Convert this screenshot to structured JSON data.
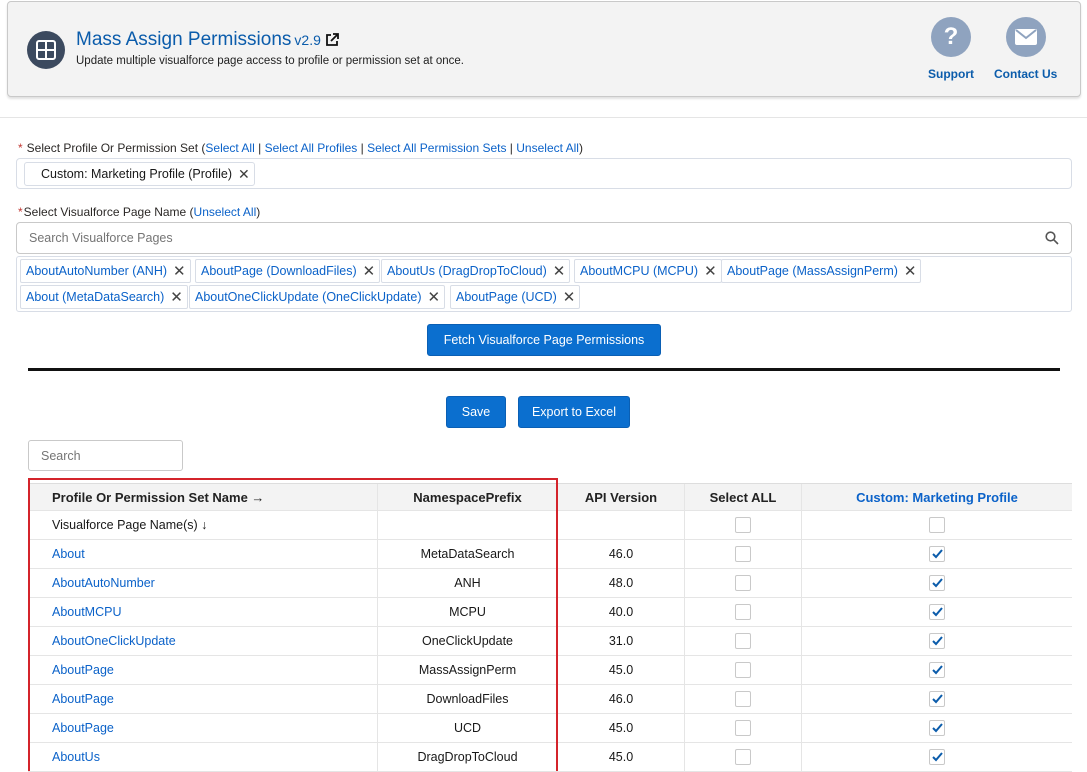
{
  "header": {
    "title": "Mass Assign Permissions",
    "version": "v2.9",
    "subtitle": "Update multiple visualforce page access to profile or permission set at once.",
    "support_label": "Support",
    "contact_label": "Contact Us"
  },
  "profile_select": {
    "required_mark": "*",
    "label": "Select Profile Or Permission Set (",
    "select_all": "Select All",
    "sep1": " | ",
    "select_all_profiles": "Select All Profiles",
    "sep2": " | ",
    "select_all_permsets": "Select All Permission Sets",
    "sep3": " | ",
    "unselect_all": "Unselect All",
    "close_paren": ")",
    "selected_pill": "Custom: Marketing Profile (Profile)"
  },
  "vf_select": {
    "required_mark": "*",
    "label": "Select Visualforce Page Name (",
    "unselect_all": "Unselect All",
    "close_paren": ")",
    "search_placeholder": "Search Visualforce Pages",
    "pills": [
      "AboutAutoNumber (ANH)",
      "AboutPage (DownloadFiles)",
      "AboutUs (DragDropToCloud)",
      "AboutMCPU (MCPU)",
      "AboutPage (MassAssignPerm)",
      "About (MetaDataSearch)",
      "AboutOneClickUpdate (OneClickUpdate)",
      "AboutPage (UCD)"
    ]
  },
  "buttons": {
    "fetch": "Fetch Visualforce Page Permissions",
    "save": "Save",
    "export": "Export to Excel"
  },
  "table_search_placeholder": "Search",
  "table": {
    "headers": [
      "Profile Or Permission Set Name →",
      "NamespacePrefix",
      "API Version",
      "Select ALL",
      "Custom: Marketing Profile"
    ],
    "subheader_label": "Visualforce Page Name(s) ↓",
    "rows": [
      {
        "name": "About",
        "ns": "MetaDataSearch",
        "api": "46.0",
        "select_all": false,
        "marketing": true
      },
      {
        "name": "AboutAutoNumber",
        "ns": "ANH",
        "api": "48.0",
        "select_all": false,
        "marketing": true
      },
      {
        "name": "AboutMCPU",
        "ns": "MCPU",
        "api": "40.0",
        "select_all": false,
        "marketing": true
      },
      {
        "name": "AboutOneClickUpdate",
        "ns": "OneClickUpdate",
        "api": "31.0",
        "select_all": false,
        "marketing": true
      },
      {
        "name": "AboutPage",
        "ns": "MassAssignPerm",
        "api": "45.0",
        "select_all": false,
        "marketing": true
      },
      {
        "name": "AboutPage",
        "ns": "DownloadFiles",
        "api": "46.0",
        "select_all": false,
        "marketing": true
      },
      {
        "name": "AboutPage",
        "ns": "UCD",
        "api": "45.0",
        "select_all": false,
        "marketing": true
      },
      {
        "name": "AboutUs",
        "ns": "DragDropToCloud",
        "api": "45.0",
        "select_all": false,
        "marketing": true
      }
    ]
  },
  "colors": {
    "link": "#0b62c9",
    "button": "#0b6fcf",
    "highlight_border": "#d4242b",
    "check": "#0b5cab"
  }
}
